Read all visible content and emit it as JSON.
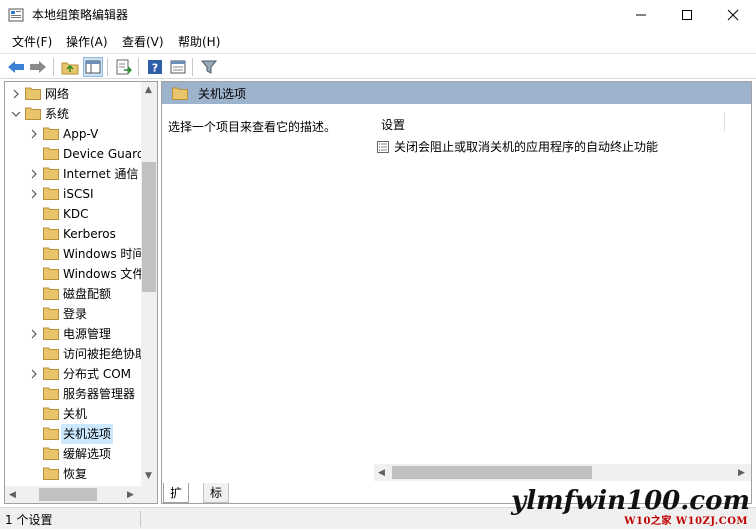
{
  "window": {
    "title": "本地组策略编辑器"
  },
  "menu": [
    "文件(F)",
    "操作(A)",
    "查看(V)",
    "帮助(H)"
  ],
  "toolbar": {
    "icons": [
      "back-arrow-icon",
      "forward-arrow-icon",
      "up-folder-icon",
      "show-hide-tree-icon",
      "export-list-icon",
      "help-icon",
      "properties-icon",
      "filter-icon"
    ]
  },
  "tree": {
    "items": [
      {
        "label": "网络",
        "expanded": false
      },
      {
        "label": "系统",
        "expanded": true
      },
      {
        "label": "App-V",
        "expanded": false
      },
      {
        "label": "Device Guard",
        "expanded": false
      },
      {
        "label": "Internet 通信",
        "expanded": false
      },
      {
        "label": "iSCSI",
        "expanded": false
      },
      {
        "label": "KDC",
        "expanded": false
      },
      {
        "label": "Kerberos",
        "expanded": false
      },
      {
        "label": "Windows 时间",
        "expanded": false
      },
      {
        "label": "Windows 文件",
        "expanded": false
      },
      {
        "label": "磁盘配额",
        "expanded": false
      },
      {
        "label": "登录",
        "expanded": false
      },
      {
        "label": "电源管理",
        "expanded": false
      },
      {
        "label": "访问被拒绝协助",
        "expanded": false
      },
      {
        "label": "分布式 COM",
        "expanded": false
      },
      {
        "label": "服务器管理器",
        "expanded": false
      },
      {
        "label": "关机",
        "expanded": false
      },
      {
        "label": "关机选项",
        "selected": true
      },
      {
        "label": "缓解选项",
        "expanded": false
      },
      {
        "label": "恢复",
        "expanded": false
      }
    ]
  },
  "right": {
    "header": "关机选项",
    "description": "选择一个项目来查看它的描述。",
    "column": "设置",
    "settings": [
      "关闭会阻止或取消关机的应用程序的自动终止功能"
    ]
  },
  "tabs": {
    "extended": "扩展",
    "standard": "标准"
  },
  "status": {
    "text": "1 个设置"
  },
  "watermark": {
    "main": "ylmfwin100.com",
    "sub": "W10之家 W10ZJ.COM"
  },
  "colors": {
    "header_bar": "#9db3cc",
    "selection": "#cce8ff",
    "folder": "#e8c46a"
  }
}
